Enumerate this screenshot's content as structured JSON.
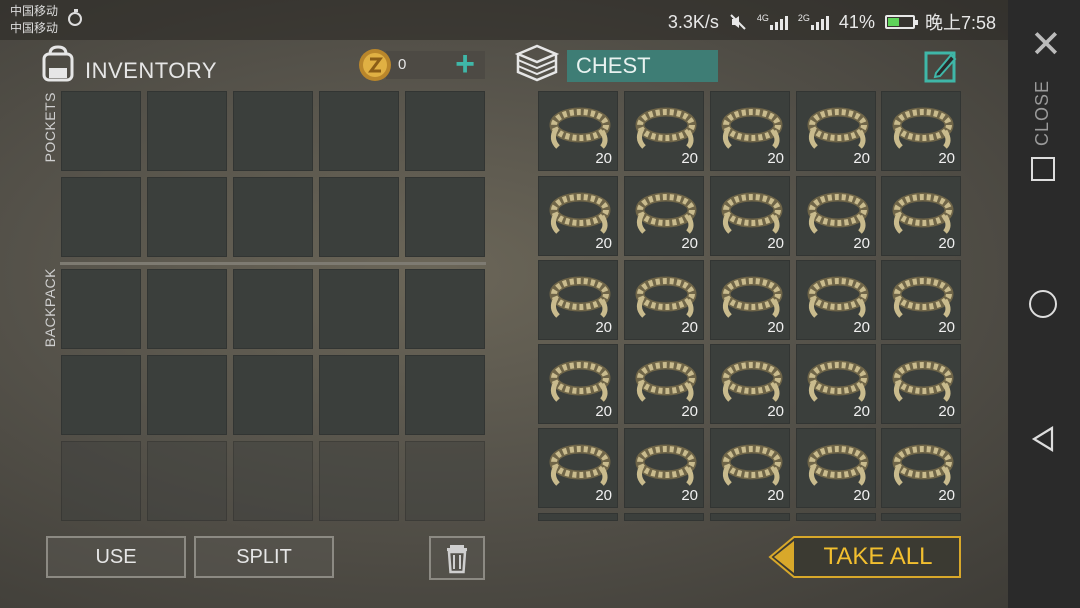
{
  "status_bar": {
    "carrier_1": "中国移动",
    "carrier_2": "中国移动",
    "net_speed": "3.3K/s",
    "network_1": "4G",
    "network_2": "2G",
    "battery": "41%",
    "battery_level": 0.41,
    "time": "晚上7:58"
  },
  "inventory": {
    "title": "INVENTORY",
    "coins": "0",
    "add_symbol": "+",
    "pockets_label": "POCKETS",
    "backpack_label": "BACKPACK",
    "pocket_rows": 2,
    "backpack_rows": 2,
    "locked_rows": 1,
    "columns": 5,
    "buttons": {
      "use": "USE",
      "split": "SPLIT"
    }
  },
  "chest": {
    "title": "CHEST",
    "columns": 5,
    "items": [
      {
        "name": "rope",
        "qty": "20"
      },
      {
        "name": "rope",
        "qty": "20"
      },
      {
        "name": "rope",
        "qty": "20"
      },
      {
        "name": "rope",
        "qty": "20"
      },
      {
        "name": "rope",
        "qty": "20"
      },
      {
        "name": "rope",
        "qty": "20"
      },
      {
        "name": "rope",
        "qty": "20"
      },
      {
        "name": "rope",
        "qty": "20"
      },
      {
        "name": "rope",
        "qty": "20"
      },
      {
        "name": "rope",
        "qty": "20"
      },
      {
        "name": "rope",
        "qty": "20"
      },
      {
        "name": "rope",
        "qty": "20"
      },
      {
        "name": "rope",
        "qty": "20"
      },
      {
        "name": "rope",
        "qty": "20"
      },
      {
        "name": "rope",
        "qty": "20"
      },
      {
        "name": "rope",
        "qty": "20"
      },
      {
        "name": "rope",
        "qty": "20"
      },
      {
        "name": "rope",
        "qty": "20"
      },
      {
        "name": "rope",
        "qty": "20"
      },
      {
        "name": "rope",
        "qty": "20"
      },
      {
        "name": "rope",
        "qty": "20"
      },
      {
        "name": "rope",
        "qty": "20"
      },
      {
        "name": "rope",
        "qty": "20"
      },
      {
        "name": "rope",
        "qty": "20"
      },
      {
        "name": "rope",
        "qty": "20"
      }
    ],
    "take_all": "TAKE ALL"
  },
  "nav": {
    "close": "CLOSE"
  },
  "colors": {
    "accent": "#3fb7a8",
    "take_all": "#f2bf2f",
    "chest_header": "#3e7d75",
    "slot": "#3b3f3c"
  }
}
